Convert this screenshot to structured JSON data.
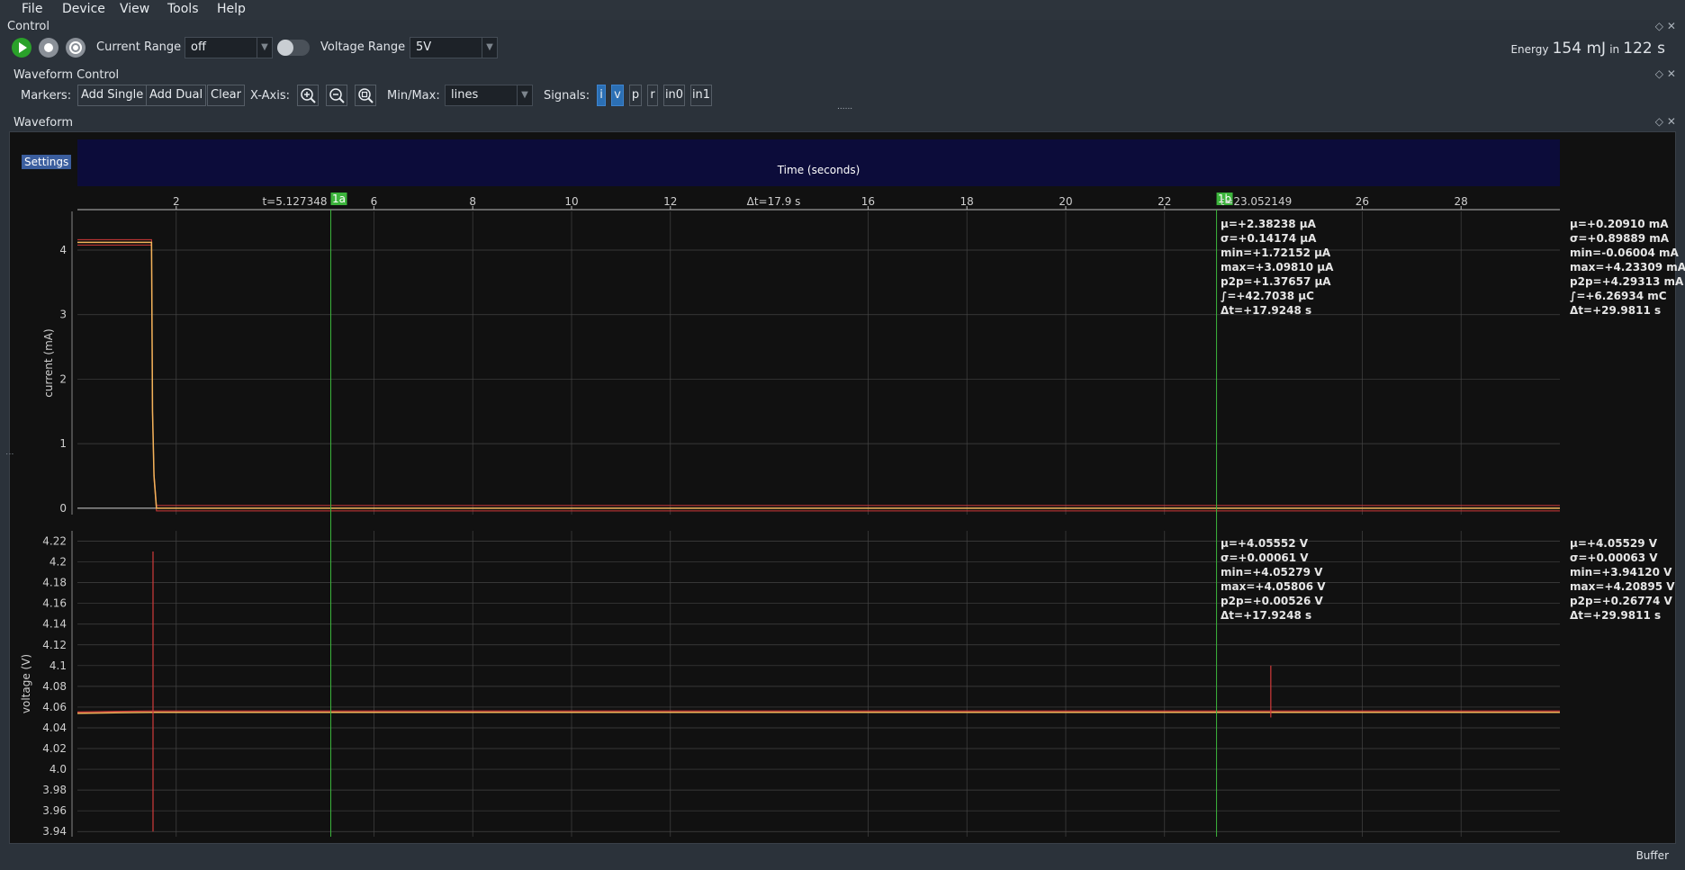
{
  "menu": [
    "File",
    "Device",
    "View",
    "Tools",
    "Help"
  ],
  "control": {
    "title": "Control",
    "current_range_label": "Current Range",
    "current_range_value": "off",
    "voltage_range_label": "Voltage Range",
    "voltage_range_value": "5V",
    "energy_label": "Energy",
    "energy_value": "154 mJ",
    "energy_in": "in",
    "energy_time": "122 s"
  },
  "waveform_control": {
    "title": "Waveform Control",
    "markers_label": "Markers:",
    "add_single": "Add Single",
    "add_dual": "Add Dual",
    "clear": "Clear",
    "xaxis_label": "X-Axis:",
    "minmax_label": "Min/Max:",
    "minmax_value": "lines",
    "signals_label": "Signals:",
    "signals": [
      {
        "label": "i",
        "on": true
      },
      {
        "label": "v",
        "on": true
      },
      {
        "label": "p",
        "on": false
      },
      {
        "label": "r",
        "on": false
      },
      {
        "label": "in0",
        "on": false
      },
      {
        "label": "in1",
        "on": false
      }
    ],
    "splitter": "......"
  },
  "waveform": {
    "title": "Waveform",
    "settings": "Settings",
    "time_title": "Time (seconds)",
    "marker_a": {
      "label": "1a",
      "time_text": "t=5.127348",
      "t": 5.127348
    },
    "marker_b": {
      "label": "1b",
      "time_text": "t=23.052149",
      "t": 23.052149
    },
    "delta_text": "Δt=17.9 s",
    "x_ticks": [
      2,
      6,
      8,
      10,
      12,
      16,
      18,
      20,
      22,
      26,
      28
    ],
    "x_range": [
      0,
      30.0
    ],
    "colors": {
      "trace_main": "#f2b35a",
      "trace_minmax": "#d23a3a",
      "marker": "#3cb43c",
      "grid": "#444444"
    }
  },
  "chart_data": [
    {
      "type": "line",
      "ylabel": "current (mA)",
      "ylim": [
        -0.1,
        4.6
      ],
      "yticks": [
        0,
        1,
        2,
        3,
        4
      ],
      "series": [
        {
          "name": "",
          "x": [
            0.0,
            1.5,
            1.52,
            1.55,
            1.6,
            30.0
          ],
          "values": [
            4.12,
            4.12,
            1.5,
            0.5,
            0.0,
            0.0
          ]
        }
      ],
      "stats_marker": [
        "μ=+2.38238 μA",
        "σ=+0.14174 μA",
        "min=+1.72152 μA",
        "max=+3.09810 μA",
        "p2p=+1.37657 μA",
        "∫=+42.7038 μC",
        "Δt=+17.9248 s"
      ],
      "stats_total": [
        "μ=+0.20910 mA",
        "σ=+0.89889 mA",
        "min=-0.06004 mA",
        "max=+4.23309 mA",
        "p2p=+4.29313 mA",
        "∫=+6.26934 mC",
        "Δt=+29.9811 s"
      ]
    },
    {
      "type": "line",
      "ylabel": "voltage (V)",
      "ylim": [
        3.935,
        4.23
      ],
      "yticks": [
        3.94,
        3.96,
        3.98,
        4.0,
        4.02,
        4.04,
        4.06,
        4.08,
        4.1,
        4.12,
        4.14,
        4.16,
        4.18,
        4.2,
        4.22
      ],
      "ytick_labels": [
        "3.94",
        "3.96",
        "3.98",
        "4.0",
        "4.02",
        "4.04",
        "4.06",
        "4.08",
        "4.1",
        "4.12",
        "4.14",
        "4.16",
        "4.18",
        "4.2",
        "4.22"
      ],
      "series": [
        {
          "name": "",
          "x": [
            0.0,
            1.5,
            30.0
          ],
          "values": [
            4.054,
            4.055,
            4.055
          ]
        }
      ],
      "spikes": [
        {
          "t": 1.53,
          "min": 3.94,
          "max": 4.21
        },
        {
          "t": 24.15,
          "min": 4.05,
          "max": 4.1
        }
      ],
      "stats_marker": [
        "μ=+4.05552  V",
        "σ=+0.00061  V",
        "min=+4.05279  V",
        "max=+4.05806  V",
        "p2p=+0.00526  V",
        "Δt=+17.9248  s"
      ],
      "stats_total": [
        "μ=+4.05529  V",
        "σ=+0.00063  V",
        "min=+3.94120  V",
        "max=+4.20895  V",
        "p2p=+0.26774  V",
        "Δt=+29.9811  s"
      ]
    }
  ],
  "status": {
    "buffer": "Buffer"
  }
}
